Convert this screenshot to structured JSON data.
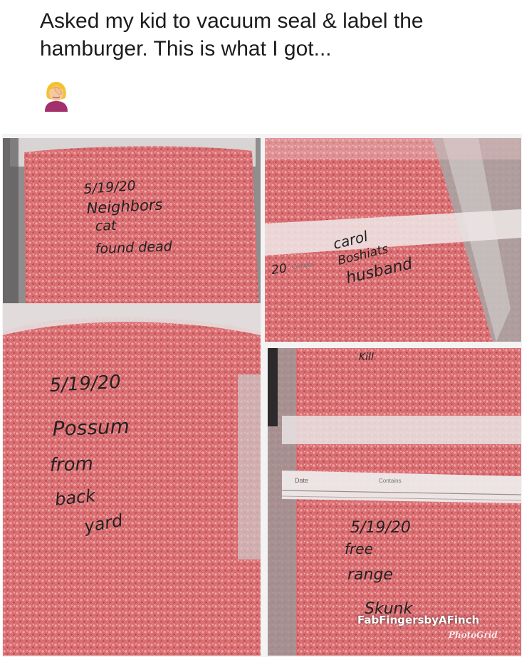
{
  "post": {
    "caption": "Asked my kid to vacuum seal & label the hamburger. This is what I got...",
    "emoji": "woman-facepalming-emoji"
  },
  "photos": [
    {
      "label_lines": [
        "5/19/20",
        "Neighbors",
        "cat",
        "found dead"
      ]
    },
    {
      "label_lines": [
        "20",
        "Contains",
        "carol",
        "Boshiats",
        "husband"
      ]
    },
    {
      "label_lines": [
        "5/19/20",
        "Possum",
        "from",
        "back",
        "yard"
      ]
    },
    {
      "label_lines": [
        "Kill",
        "Date",
        "Contains",
        "5/19/20",
        "free",
        "range",
        "Skunk"
      ]
    }
  ],
  "watermark": {
    "text": "FabFingersbyAFinch",
    "sub": "PhotoGrid"
  },
  "colors": {
    "meat": "#d86a6e",
    "meat_light": "#ee9a9c",
    "plastic": "#c9c5c5",
    "background": "#ffffff"
  }
}
